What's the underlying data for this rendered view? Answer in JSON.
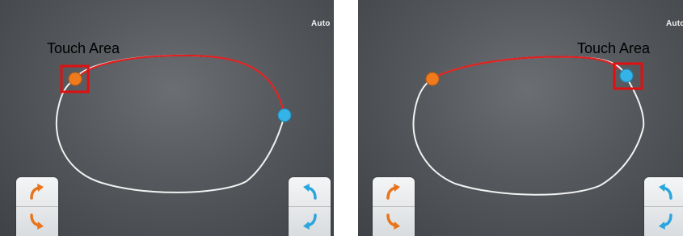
{
  "panels": [
    {
      "mode_label": "Auto",
      "touch_label": "Touch Area",
      "highlighted_handle": "orange"
    },
    {
      "mode_label": "Auto",
      "touch_label": "Touch Area",
      "highlighted_handle": "blue"
    }
  ],
  "colors": {
    "orange_handle": "#f07a1e",
    "blue_handle": "#35b3e6",
    "frame_outline": "#f2f2f2",
    "selected_segment": "#e02020",
    "touch_box": "#e01010"
  },
  "icons": {
    "rotate_cw_orange": "curved-arrow-up-right-icon",
    "rotate_ccw_orange": "curved-arrow-down-right-icon",
    "rotate_ccw_blue": "curved-arrow-up-left-icon",
    "rotate_cw_blue": "curved-arrow-down-left-icon"
  }
}
